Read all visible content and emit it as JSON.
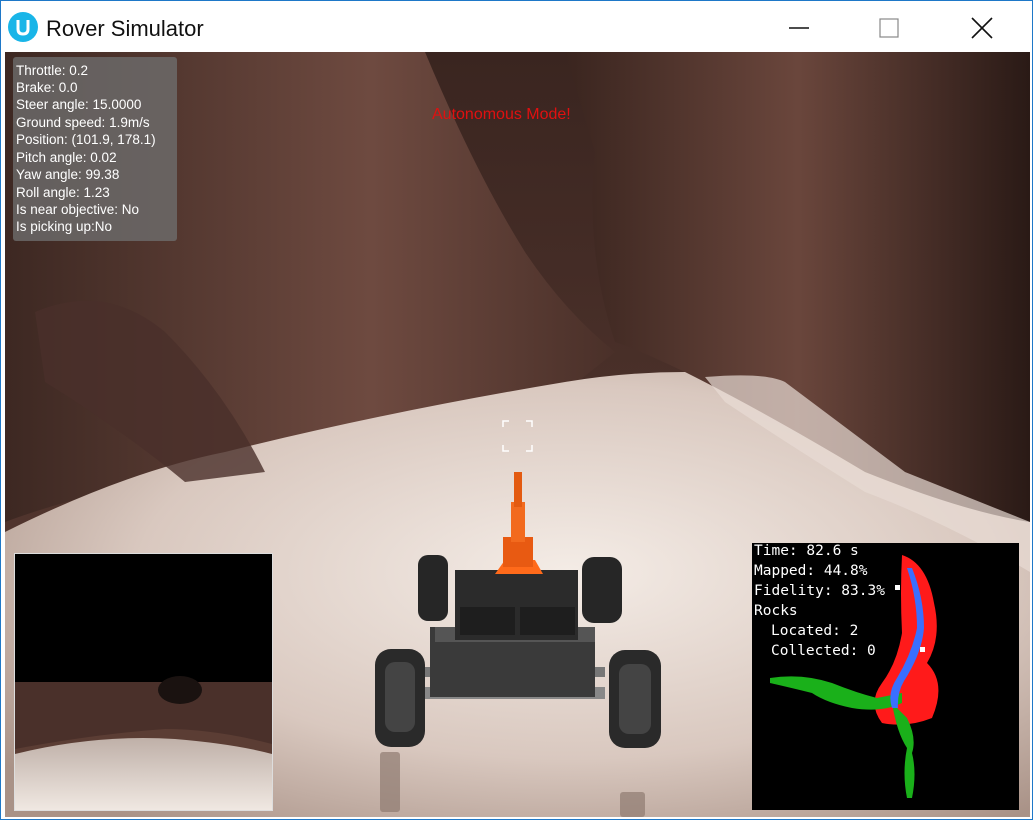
{
  "window": {
    "title": "Rover Simulator",
    "accent_color": "#19b5e8",
    "controls": {
      "minimize_icon": "minimize-icon",
      "maximize_icon": "maximize-icon",
      "close_icon": "close-icon"
    }
  },
  "telemetry": {
    "throttle": "Throttle: 0.2",
    "brake": "Brake: 0.0",
    "steer": "Steer angle: 15.0000",
    "speed": "Ground speed: 1.9m/s",
    "position": "Position: (101.9, 178.1)",
    "pitch": "Pitch angle: 0.02",
    "yaw": "Yaw angle: 99.38",
    "roll": "Roll angle: 1.23",
    "near_objective": "Is near objective: No",
    "picking_up": "Is picking up:No"
  },
  "mode_text": "Autonomous Mode!",
  "mode_color": "#e01010",
  "map": {
    "time": "Time: 82.6 s",
    "mapped": "Mapped: 44.8%",
    "fidelity": "Fidelity: 83.3%",
    "rocks": "Rocks",
    "located": "Located: 2",
    "collected": "Collected: 0"
  }
}
